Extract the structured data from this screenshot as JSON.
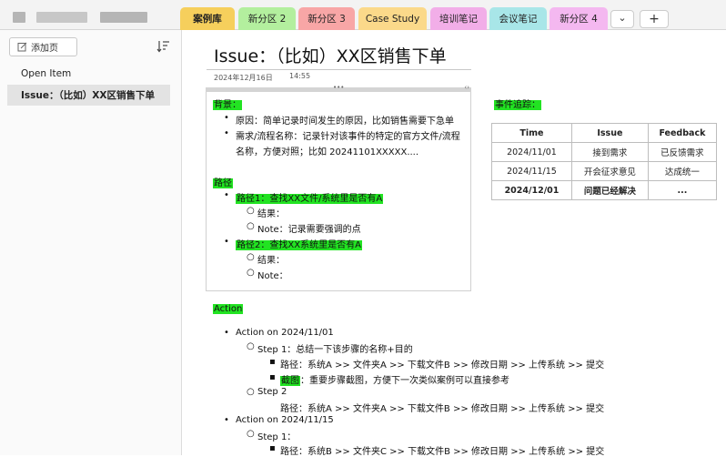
{
  "tabs": [
    {
      "label": "案例库",
      "color": "#f6cf5c"
    },
    {
      "label": "新分区 2",
      "color": "#b3ef9e"
    },
    {
      "label": "新分区 3",
      "color": "#f8a6a6"
    },
    {
      "label": "Case Study",
      "color": "#fbd98a"
    },
    {
      "label": "培训笔记",
      "color": "#f2aee8"
    },
    {
      "label": "会议笔记",
      "color": "#a8e6e8"
    },
    {
      "label": "新分区 4",
      "color": "#f4b8f0"
    }
  ],
  "tab_more": "⌄",
  "tab_add": "+",
  "sidebar": {
    "add_page": "添加页",
    "items": [
      "Open Item",
      "Issue：（比如）XX区销售下单"
    ]
  },
  "page": {
    "title": "Issue：（比如）XX区销售下单",
    "date": "2024年12月16日",
    "time": "14:55"
  },
  "left_block": {
    "background_label": "背景：",
    "background_items": [
      "原因：简单记录时间发生的原因，比如销售需要下急单",
      "需求/流程名称：记录针对该事件的特定的官方文件/流程",
      "名称，方便对照；比如 20241101XXXXX...."
    ],
    "path_label": "路径",
    "path1": "路径1：查找XX文件/系统里是否有A",
    "path1_result": "结果：",
    "path1_note": "Note：记录需要强调的点",
    "path2": "路径2：查找XX系统里是否有A",
    "path2_result": "结果：",
    "path2_note": "Note："
  },
  "events": {
    "label": "事件追踪：",
    "headers": [
      "Time",
      "Issue",
      "Feedback"
    ],
    "rows": [
      [
        "2024/11/01",
        "接到需求",
        "已反馈需求"
      ],
      [
        "2024/11/15",
        "开会征求意见",
        "达成统一"
      ],
      [
        "2024/12/01",
        "问题已经解决",
        "..."
      ]
    ]
  },
  "action": {
    "label": "Action",
    "a1": "Action on 2024/11/01",
    "a1_step1": "Step 1：总结一下该步骤的名称+目的",
    "a1_step1_path": "路径：系统A >> 文件夹A >> 下载文件B >> 修改日期 >> 上传系统 >> 提交",
    "a1_step1_shot_label": "截图",
    "a1_step1_shot": "：重要步骤截图，方便下一次类似案例可以直接参考",
    "a1_step2": "Step 2",
    "a1_step2_path": "路径：系统A >> 文件夹A >> 下载文件B >> 修改日期 >> 上传系统 >> 提交",
    "a2": "Action on 2024/11/15",
    "a2_step1": "Step 1：",
    "a2_step1_path": "路径：系统B >> 文件夹C >> 下载文件B >> 修改日期 >> 上传系统 >> 提交"
  }
}
